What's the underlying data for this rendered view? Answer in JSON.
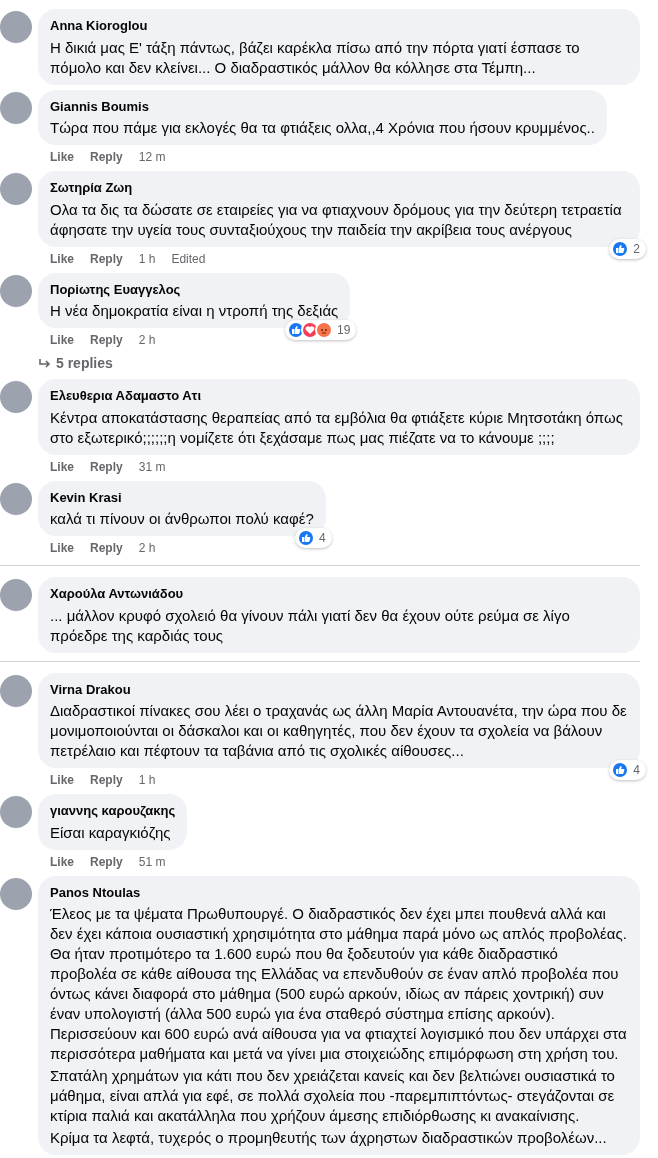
{
  "sections": [
    {
      "comments": [
        {
          "name": "Anna Kioroglou",
          "paragraphs": [
            "Η δικιά μας Ε' τάξη πάντως, βάζει καρέκλα πίσω από την πόρτα γιατί έσπασε το πόμολο και δεν κλείνει... Ο διαδραστικός μάλλον θα κόλλησε στα Τέμπη..."
          ]
        },
        {
          "name": "Giannis Boumis",
          "paragraphs": [
            "Τώρα που πάμε για εκλογές θα τα φτιάξεις ολλα,,4 Χρόνια που ήσουν κρυμμένος.."
          ],
          "actions": [
            "Like",
            "Reply"
          ],
          "time": "12 m"
        },
        {
          "name": "Σωτηρία Ζωη",
          "paragraphs": [
            "Ολα τα δις τα δώσατε σε εταιρείες για να φτιαχνουν δρόμους για την δεύτερη τετραετία άφησατε την υγεία τους συνταξιούχους την παιδεία την ακρίβεια τους ανέργους"
          ],
          "actions": [
            "Like",
            "Reply"
          ],
          "time": "1 h",
          "edited": "Edited",
          "reactions": {
            "kinds": [
              {
                "kind": "like"
              }
            ],
            "count": "2"
          }
        },
        {
          "name": "Πορiωτης Ευαγγελος",
          "paragraphs": [
            "Η νέα δημοκρατία είναι η ντροπή της δεξιάς"
          ],
          "actions": [
            "Like",
            "Reply"
          ],
          "time": "2 h",
          "reactions": {
            "kinds": [
              {
                "kind": "like"
              },
              {
                "kind": "love"
              },
              {
                "kind": "angry"
              }
            ],
            "count": "19"
          },
          "replies": "5 replies"
        },
        {
          "name": "Ελευθερια Αδαμαστο Ατι",
          "paragraphs": [
            "Κέντρα αποκατάστασης θεραπείας από τα εμβόλια θα φτιάξετε κύριε Μητσοτάκη όπως στο εξωτερικό;;;;;;η νομίζετε ότι ξεχάσαμε πως μας πιέζατε να το κάνουμε ;;;;"
          ],
          "actions": [
            "Like",
            "Reply"
          ],
          "time": "31 m"
        },
        {
          "name": "Kevin Krasi",
          "paragraphs": [
            "καλά τι πίνουν οι άνθρωποι πολύ καφέ?"
          ],
          "actions": [
            "Like",
            "Reply"
          ],
          "time": "2 h",
          "reactions": {
            "kinds": [
              {
                "kind": "like"
              }
            ],
            "count": "4"
          }
        }
      ]
    },
    {
      "comments": [
        {
          "name": "Χαρούλα Αντωνιάδου",
          "paragraphs": [
            "... μάλλον κρυφό σχολειό θα γίνουν πάλι γιατί δεν θα έχουν ούτε ρεύμα σε λίγο πρόεδρε της καρδιάς τους"
          ]
        }
      ]
    },
    {
      "comments": [
        {
          "name": "Virna Drakou",
          "paragraphs": [
            "Διαδραστικοί πίνακες σου λέει ο τραχανάς ως άλλη Μαρία Αντουανέτα, την ώρα που δε μονιμοποιούνται οι δάσκαλοι και οι καθηγητές, που δεν έχουν τα σχολεία να βάλουν πετρέλαιο και πέφτουν τα ταβάνια από τις σχολικές αίθουσες..."
          ],
          "actions": [
            "Like",
            "Reply"
          ],
          "time": "1 h",
          "reactions": {
            "kinds": [
              {
                "kind": "like"
              }
            ],
            "count": "4"
          }
        },
        {
          "name": "γιαννης καρουζακης",
          "paragraphs": [
            "Είσαι καραγκιόζης"
          ],
          "actions": [
            "Like",
            "Reply"
          ],
          "time": "51 m"
        },
        {
          "name": "Panos Ntoulas",
          "paragraphs": [
            "Έλεος με τα ψέματα Πρωθυπουργέ. Ο διαδραστικός δεν έχει μπει πουθενά αλλά και δεν έχει κάποια ουσιαστική χρησιμότητα στο μάθημα παρά μόνο ως απλός προβολέας. Θα ήταν προτιμότερο τα 1.600 ευρώ που θα ξοδευτούν για κάθε διαδραστικό προβολέα σε κάθε αίθουσα της Ελλάδας να επενδυθούν σε έναν απλό προβολέα που όντως κάνει διαφορά στο μάθημα (500 ευρώ αρκούν, ιδίως αν πάρεις χοντρική) συν έναν υπολογιστή (άλλα 500 ευρώ για ένα σταθερό σύστημα επίσης αρκούν). Περισσεύουν και 600 ευρώ ανά αίθουσα για να φτιαχτεί λογισμικό που δεν υπάρχει στα περισσότερα μαθήματα και μετά να γίνει μια στοιχειώδης επιμόρφωση στη χρήση του.",
            "Σπατάλη χρημάτων για κάτι που δεν χρειάζεται κανείς και δεν βελτιώνει ουσιαστικά το μάθημα, είναι απλά για εφέ, σε πολλά σχολεία που -παρεμπιπτόντως- στεγάζονται σε κτίρια παλιά και ακατάλληλα που χρήζουν άμεσης επιδιόρθωσης κι ανακαίνισης.",
            "Κρίμα τα λεφτά, τυχερός ο προμηθευτής των άχρηστων διαδραστικών προβολέων..."
          ]
        }
      ]
    }
  ]
}
